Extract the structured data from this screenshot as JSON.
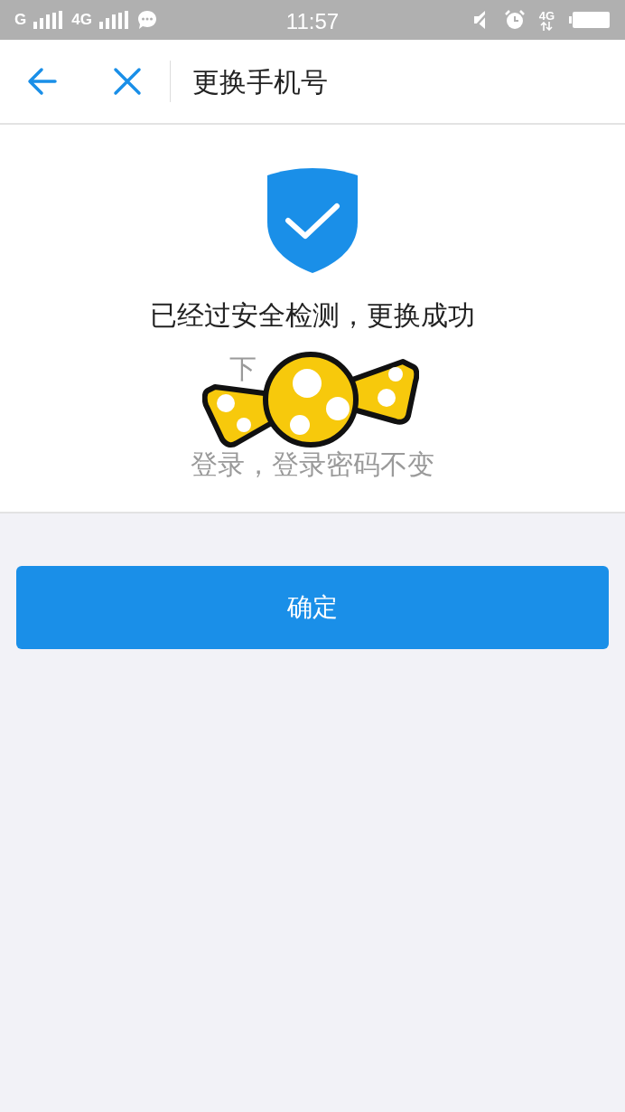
{
  "status_bar": {
    "left": [
      {
        "kind": "text",
        "text": "G"
      },
      {
        "kind": "signal"
      },
      {
        "kind": "text",
        "text": "4G"
      },
      {
        "kind": "signal"
      },
      {
        "kind": "chat"
      }
    ],
    "time": "11:57",
    "right": [
      {
        "kind": "mute"
      },
      {
        "kind": "alarm"
      },
      {
        "kind": "network",
        "text": "4G"
      },
      {
        "kind": "battery"
      }
    ]
  },
  "header": {
    "title": "更换手机号"
  },
  "result": {
    "title": "已经过安全检测，更换成功",
    "message_lines": [
      "下",
      "登录，登录密码不变"
    ]
  },
  "confirm_button": {
    "label": "确定"
  }
}
